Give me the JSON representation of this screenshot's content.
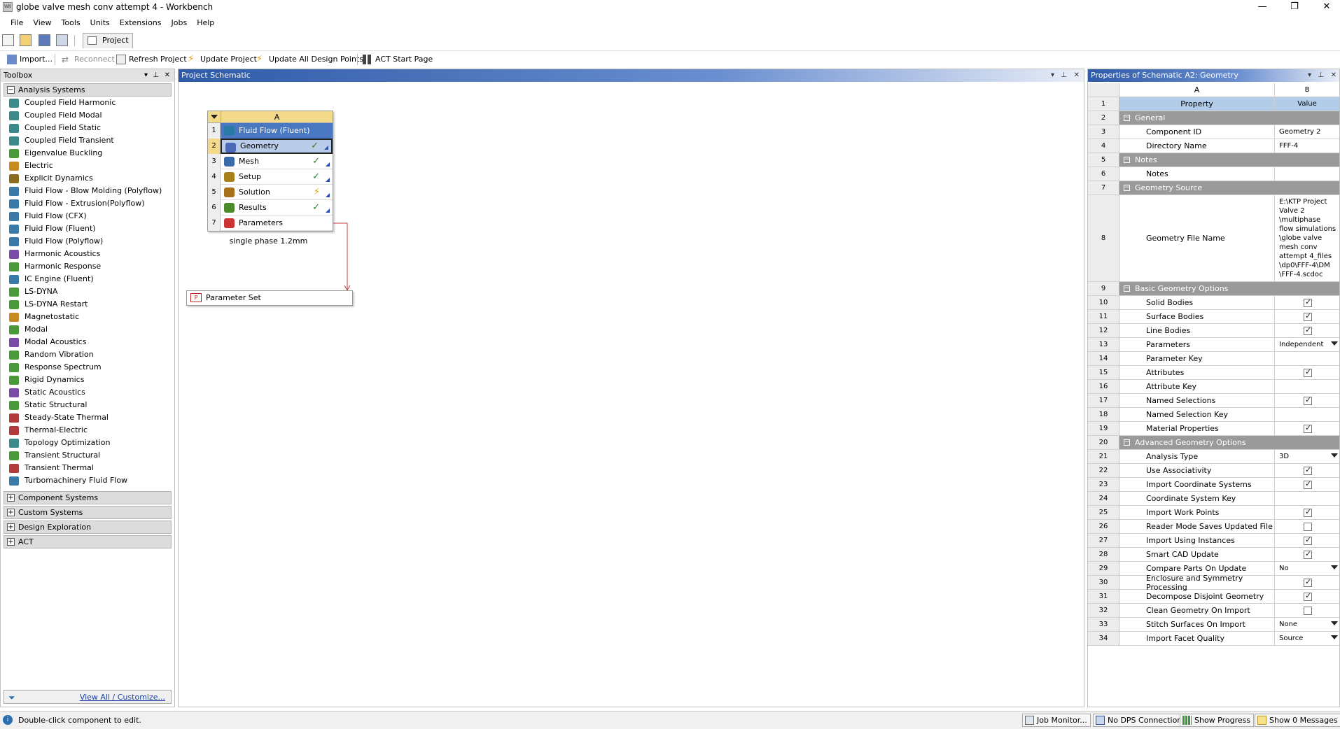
{
  "window": {
    "title": "globe valve mesh conv attempt 4 - Workbench",
    "app_icon_text": "WB",
    "minimize": "—",
    "restore": "❐",
    "close": "✕"
  },
  "menu": [
    "File",
    "View",
    "Tools",
    "Units",
    "Extensions",
    "Jobs",
    "Help"
  ],
  "tab": {
    "label": "Project"
  },
  "toolbar": {
    "import": "Import...",
    "reconnect": "Reconnect",
    "refresh": "Refresh Project",
    "update": "Update Project",
    "update_all": "Update All Design Points",
    "act": "ACT Start Page"
  },
  "toolbox": {
    "title": "Toolbox",
    "groups": {
      "analysis": "Analysis Systems",
      "component": "Component Systems",
      "custom": "Custom Systems",
      "design": "Design Exploration",
      "act": "ACT"
    },
    "items": [
      "Coupled Field Harmonic",
      "Coupled Field Modal",
      "Coupled Field Static",
      "Coupled Field Transient",
      "Eigenvalue Buckling",
      "Electric",
      "Explicit Dynamics",
      "Fluid Flow - Blow Molding (Polyflow)",
      "Fluid Flow - Extrusion(Polyflow)",
      "Fluid Flow (CFX)",
      "Fluid Flow (Fluent)",
      "Fluid Flow (Polyflow)",
      "Harmonic Acoustics",
      "Harmonic Response",
      "IC Engine (Fluent)",
      "LS-DYNA",
      "LS-DYNA Restart",
      "Magnetostatic",
      "Modal",
      "Modal Acoustics",
      "Random Vibration",
      "Response Spectrum",
      "Rigid Dynamics",
      "Static Acoustics",
      "Static Structural",
      "Steady-State Thermal",
      "Thermal-Electric",
      "Topology Optimization",
      "Transient Structural",
      "Transient Thermal",
      "Turbomachinery Fluid Flow"
    ],
    "footer_link": "View All / Customize..."
  },
  "schematic": {
    "title": "Project Schematic",
    "system": {
      "column": "A",
      "rows": [
        {
          "n": "1",
          "label": "Fluid Flow (Fluent)",
          "status": ""
        },
        {
          "n": "2",
          "label": "Geometry",
          "status": "✓"
        },
        {
          "n": "3",
          "label": "Mesh",
          "status": "✓"
        },
        {
          "n": "4",
          "label": "Setup",
          "status": "✓"
        },
        {
          "n": "5",
          "label": "Solution",
          "status": "⚡"
        },
        {
          "n": "6",
          "label": "Results",
          "status": "✓"
        },
        {
          "n": "7",
          "label": "Parameters",
          "status": ""
        }
      ],
      "caption": "single phase 1.2mm"
    },
    "parameter_set": "Parameter Set"
  },
  "properties": {
    "title": "Properties of Schematic A2: Geometry",
    "col_a": "A",
    "col_b": "B",
    "rows": [
      {
        "n": "1",
        "type": "cap",
        "a": "Property",
        "b": "Value"
      },
      {
        "n": "2",
        "type": "sec",
        "a": "General"
      },
      {
        "n": "3",
        "a": "Component ID",
        "b": "Geometry 2"
      },
      {
        "n": "4",
        "a": "Directory Name",
        "b": "FFF-4"
      },
      {
        "n": "5",
        "type": "sec",
        "a": "Notes"
      },
      {
        "n": "6",
        "a": "Notes",
        "b": ""
      },
      {
        "n": "7",
        "type": "sec",
        "a": "Geometry Source"
      },
      {
        "n": "8",
        "a": "Geometry File Name",
        "b": "E:\\KTP Project\nValve 2\n\\multiphase\nflow simulations\n\\globe valve\nmesh conv\nattempt 4_files\n\\dp0\\FFF-4\\DM\n\\FFF-4.scdoc",
        "tall": true
      },
      {
        "n": "9",
        "type": "sec",
        "a": "Basic Geometry Options"
      },
      {
        "n": "10",
        "a": "Solid Bodies",
        "chk": true
      },
      {
        "n": "11",
        "a": "Surface Bodies",
        "chk": true
      },
      {
        "n": "12",
        "a": "Line Bodies",
        "chk": true
      },
      {
        "n": "13",
        "a": "Parameters",
        "b": "Independent",
        "dd": true
      },
      {
        "n": "14",
        "a": "Parameter Key",
        "b": ""
      },
      {
        "n": "15",
        "a": "Attributes",
        "chk": true
      },
      {
        "n": "16",
        "a": "Attribute Key",
        "b": ""
      },
      {
        "n": "17",
        "a": "Named Selections",
        "chk": true
      },
      {
        "n": "18",
        "a": "Named Selection Key",
        "b": ""
      },
      {
        "n": "19",
        "a": "Material Properties",
        "chk": true
      },
      {
        "n": "20",
        "type": "sec",
        "a": "Advanced Geometry Options"
      },
      {
        "n": "21",
        "a": "Analysis Type",
        "b": "3D",
        "dd": true
      },
      {
        "n": "22",
        "a": "Use Associativity",
        "chk": true
      },
      {
        "n": "23",
        "a": "Import Coordinate Systems",
        "chk": true
      },
      {
        "n": "24",
        "a": "Coordinate System Key",
        "b": ""
      },
      {
        "n": "25",
        "a": "Import Work Points",
        "chk": true
      },
      {
        "n": "26",
        "a": "Reader Mode Saves Updated File",
        "chk": false
      },
      {
        "n": "27",
        "a": "Import Using Instances",
        "chk": true
      },
      {
        "n": "28",
        "a": "Smart CAD Update",
        "chk": true
      },
      {
        "n": "29",
        "a": "Compare Parts On Update",
        "b": "No",
        "dd": true
      },
      {
        "n": "30",
        "a": "Enclosure and Symmetry Processing",
        "chk": true
      },
      {
        "n": "31",
        "a": "Decompose Disjoint Geometry",
        "chk": true
      },
      {
        "n": "32",
        "a": "Clean Geometry On Import",
        "chk": false
      },
      {
        "n": "33",
        "a": "Stitch Surfaces On Import",
        "b": "None",
        "dd": true
      },
      {
        "n": "34",
        "a": "Import Facet Quality",
        "b": "Source",
        "dd": true
      }
    ]
  },
  "status": {
    "message": "Double-click component to edit.",
    "job_monitor": "Job Monitor...",
    "dps": "No DPS Connection",
    "progress": "Show Progress",
    "messages": "Show 0 Messages"
  },
  "icon_colors": [
    "#3a8a8a",
    "#3a8a8a",
    "#3a8a8a",
    "#3a8a8a",
    "#4a9a3a",
    "#c88a20",
    "#8a6a20",
    "#3a7aa8",
    "#3a7aa8",
    "#3a7aa8",
    "#3a7aa8",
    "#3a7aa8",
    "#7a4aa8",
    "#4a9a3a",
    "#3a7aa8",
    "#4a9a3a",
    "#4a9a3a",
    "#c88a20",
    "#4a9a3a",
    "#7a4aa8",
    "#4a9a3a",
    "#4a9a3a",
    "#4a9a3a",
    "#7a4aa8",
    "#4a9a3a",
    "#b23a3a",
    "#b23a3a",
    "#3a8a8a",
    "#4a9a3a",
    "#b23a3a",
    "#3a7aa8"
  ]
}
